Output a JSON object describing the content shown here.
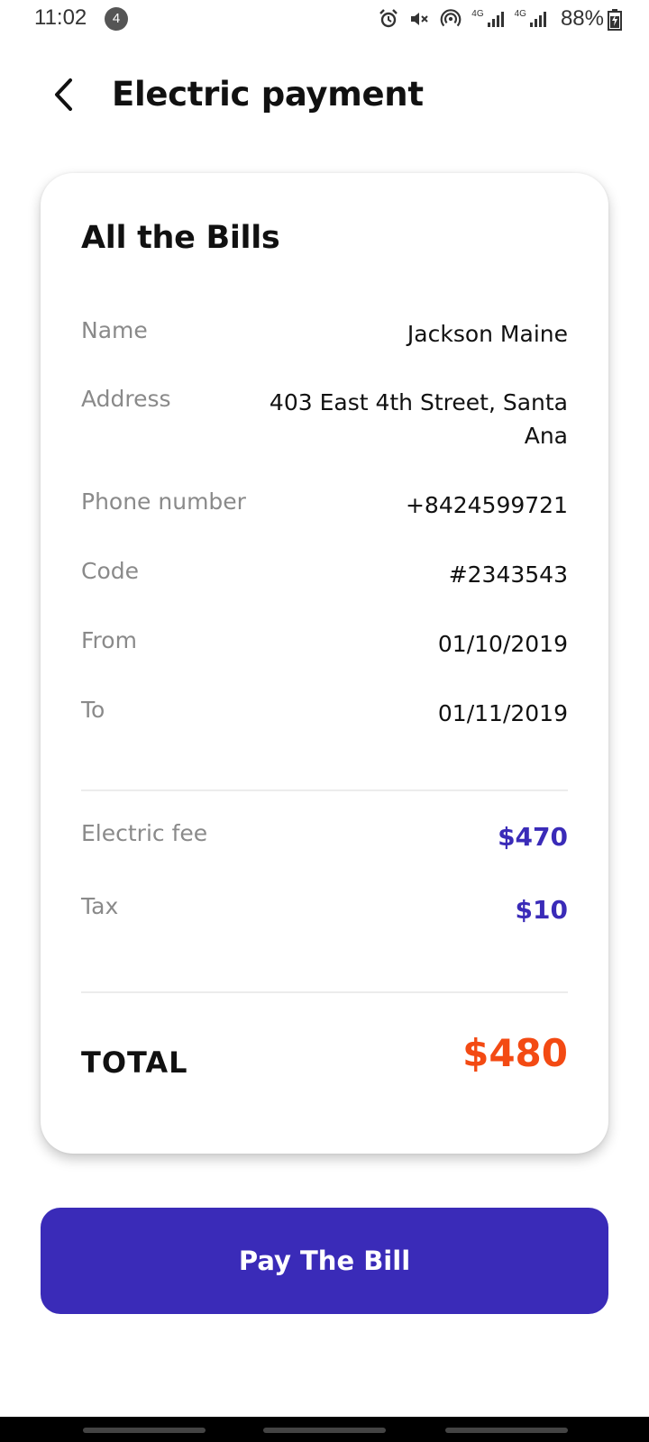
{
  "status_bar": {
    "time": "11:02",
    "notification_count": "4",
    "network_1": "4G",
    "network_2": "4G",
    "battery": "88%"
  },
  "header": {
    "title": "Electric payment"
  },
  "bill": {
    "title": "All the Bills",
    "rows": [
      {
        "label": "Name",
        "value": "Jackson Maine"
      },
      {
        "label": "Address",
        "value": "403 East 4th Street, Santa Ana"
      },
      {
        "label": "Phone number",
        "value": "+8424599721"
      },
      {
        "label": "Code",
        "value": "#2343543"
      },
      {
        "label": "From",
        "value": "01/10/2019"
      },
      {
        "label": "To",
        "value": "01/11/2019"
      }
    ],
    "fees": [
      {
        "label": "Electric fee",
        "value": "$470"
      },
      {
        "label": "Tax",
        "value": "$10"
      }
    ],
    "total_label": "TOTAL",
    "total_value": "$480"
  },
  "actions": {
    "pay_label": "Pay The Bill"
  },
  "colors": {
    "accent": "#3a2bb8",
    "total": "#f34a13"
  }
}
